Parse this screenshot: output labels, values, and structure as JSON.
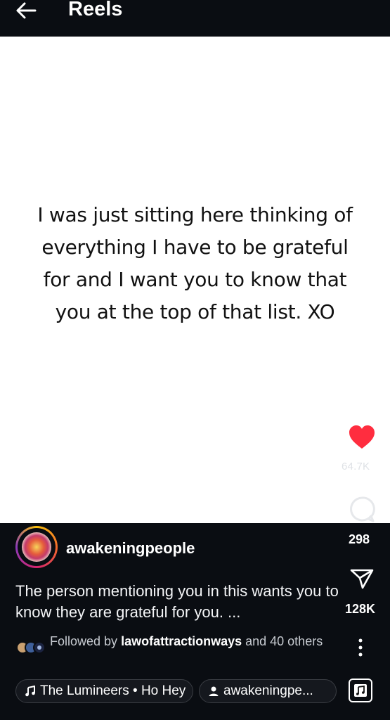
{
  "header": {
    "title": "Reels"
  },
  "reel": {
    "quote": "I was just sitting here thinking of everything I have to be grateful for and I want you to know that you at the top of that list. XO",
    "like_count": "64.7K",
    "comment_count": "298",
    "share_count": "128K"
  },
  "author": {
    "username": "awakeningpeople"
  },
  "caption": "The person mentioning you in this wants you to know they are grateful for you. ...",
  "followed_by": {
    "prefix": "Followed by ",
    "user": "lawofattractionways",
    "suffix": " and 40 others"
  },
  "music": {
    "label": "The Lumineers • Ho Hey"
  },
  "tagged_user": {
    "label": "awakeningpe..."
  },
  "colors": {
    "heart": "#ff2d3f",
    "background": "#0a0d12"
  }
}
